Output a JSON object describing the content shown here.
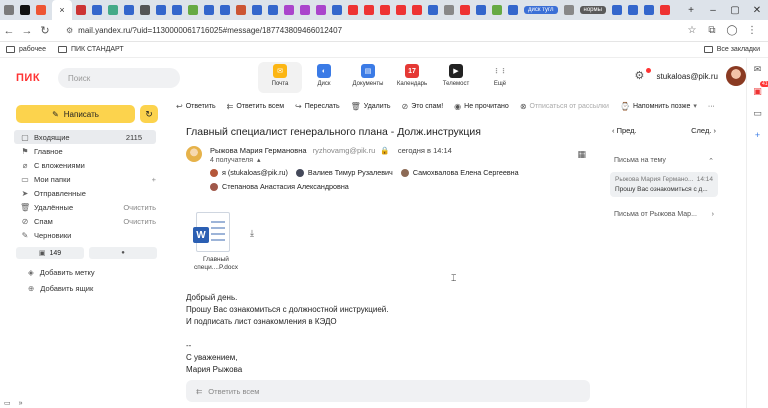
{
  "browser": {
    "tabs_pills": [
      {
        "label": "диск тугл",
        "color": "#3b6fd6"
      },
      {
        "label": "нормы",
        "color": "#5a5a5a"
      }
    ],
    "url": "mail.yandex.ru/?uid=1130000061716025#message/187743809466012407",
    "bookmarks": [
      "рабочее",
      "ПИК СТАНДАРТ"
    ],
    "bookmarks_right": "Все закладки"
  },
  "header": {
    "logo": "ПИК",
    "search_placeholder": "Поиск",
    "apps": [
      {
        "label": "Почта",
        "icon": "mail-icon",
        "color": "#fcb614",
        "selected": true
      },
      {
        "label": "Диск",
        "icon": "disk-icon",
        "color": "#3b7be6",
        "selected": false
      },
      {
        "label": "Документы",
        "icon": "documents-icon",
        "color": "#3b7be6",
        "selected": false
      },
      {
        "label": "Календарь",
        "icon": "calendar-icon",
        "color": "#e53935",
        "badge": "17",
        "selected": false
      },
      {
        "label": "Телемост",
        "icon": "telemost-icon",
        "color": "#222222",
        "selected": false
      },
      {
        "label": "Ещё",
        "icon": "grid-icon",
        "color": "#999999",
        "selected": false
      }
    ],
    "user": "stukaloas@pik.ru"
  },
  "sidebar": {
    "compose_label": "Написать",
    "folders": [
      {
        "label": "Входящие",
        "icon": "inbox-icon",
        "count": "2115",
        "selected": true
      },
      {
        "label": "Главное",
        "icon": "flag-icon",
        "count": ""
      },
      {
        "label": "С вложениями",
        "icon": "attachment-icon",
        "count": ""
      },
      {
        "label": "Мои папки",
        "icon": "folder-icon",
        "count": "",
        "action": "+"
      },
      {
        "label": "Отправленные",
        "icon": "sent-icon",
        "count": ""
      },
      {
        "label": "Удалённые",
        "icon": "trash-icon",
        "count": "",
        "action": "Очистить"
      },
      {
        "label": "Спам",
        "icon": "spam-icon",
        "count": "",
        "action": "Очистить"
      },
      {
        "label": "Черновики",
        "icon": "draft-icon",
        "count": ""
      }
    ],
    "chip_unread": "149",
    "chip_dot": "●",
    "add_label": "Добавить метку",
    "add_box": "Добавить ящик"
  },
  "toolbar": {
    "items": [
      {
        "label": "Ответить",
        "icon": "reply-icon",
        "disabled": false
      },
      {
        "label": "Ответить всем",
        "icon": "reply-all-icon",
        "disabled": false
      },
      {
        "label": "Переслать",
        "icon": "forward-icon",
        "disabled": false
      },
      {
        "label": "Удалить",
        "icon": "delete-icon",
        "disabled": false
      },
      {
        "label": "Это спам!",
        "icon": "spam-icon",
        "disabled": false
      },
      {
        "label": "Не прочитано",
        "icon": "unread-icon",
        "disabled": false
      },
      {
        "label": "Отписаться от рассылки",
        "icon": "unsubscribe-icon",
        "disabled": true
      },
      {
        "label": "Напомнить позже",
        "icon": "remind-icon",
        "disabled": false
      }
    ],
    "more": "···"
  },
  "message": {
    "subject": "Главный специалист генерального плана - Долж.инструкция",
    "sender_name": "Рыжова Мария Германовна",
    "sender_email": "ryzhovamg@pik.ru",
    "time": "сегодня в 14:14",
    "recipients_count": "4 получателя",
    "recipients": [
      [
        "я (stukaloas@pik.ru)",
        "Валиев Тимур Рузалевич",
        "Самохвалова Елена Сергеевна"
      ],
      [
        "Степанова Анастасия Александровна"
      ]
    ],
    "attachment_name": "Главный специ....P.docx",
    "attachment_name_line1": "Главный",
    "attachment_name_line2": "специ....P.docx",
    "body_lines": [
      "Добрый день.",
      "Прошу Вас ознакомиться с должностной инструкцией.",
      "И подписать лист ознакомления в КЭДО",
      "",
      "--",
      "С уважением,",
      "Мария Рыжова"
    ],
    "reply_all_placeholder": "Ответить всем"
  },
  "thread": {
    "prev": "Пред.",
    "next": "След.",
    "section_title": "Письма на тему",
    "card_sender": "Рыжова Мария Германо...",
    "card_time": "14:14",
    "card_text": "Прошу Вас ознакомиться с д...",
    "section_from": "Письма от Рыжова Мар..."
  },
  "right_sidebar": {
    "badge": "41"
  }
}
